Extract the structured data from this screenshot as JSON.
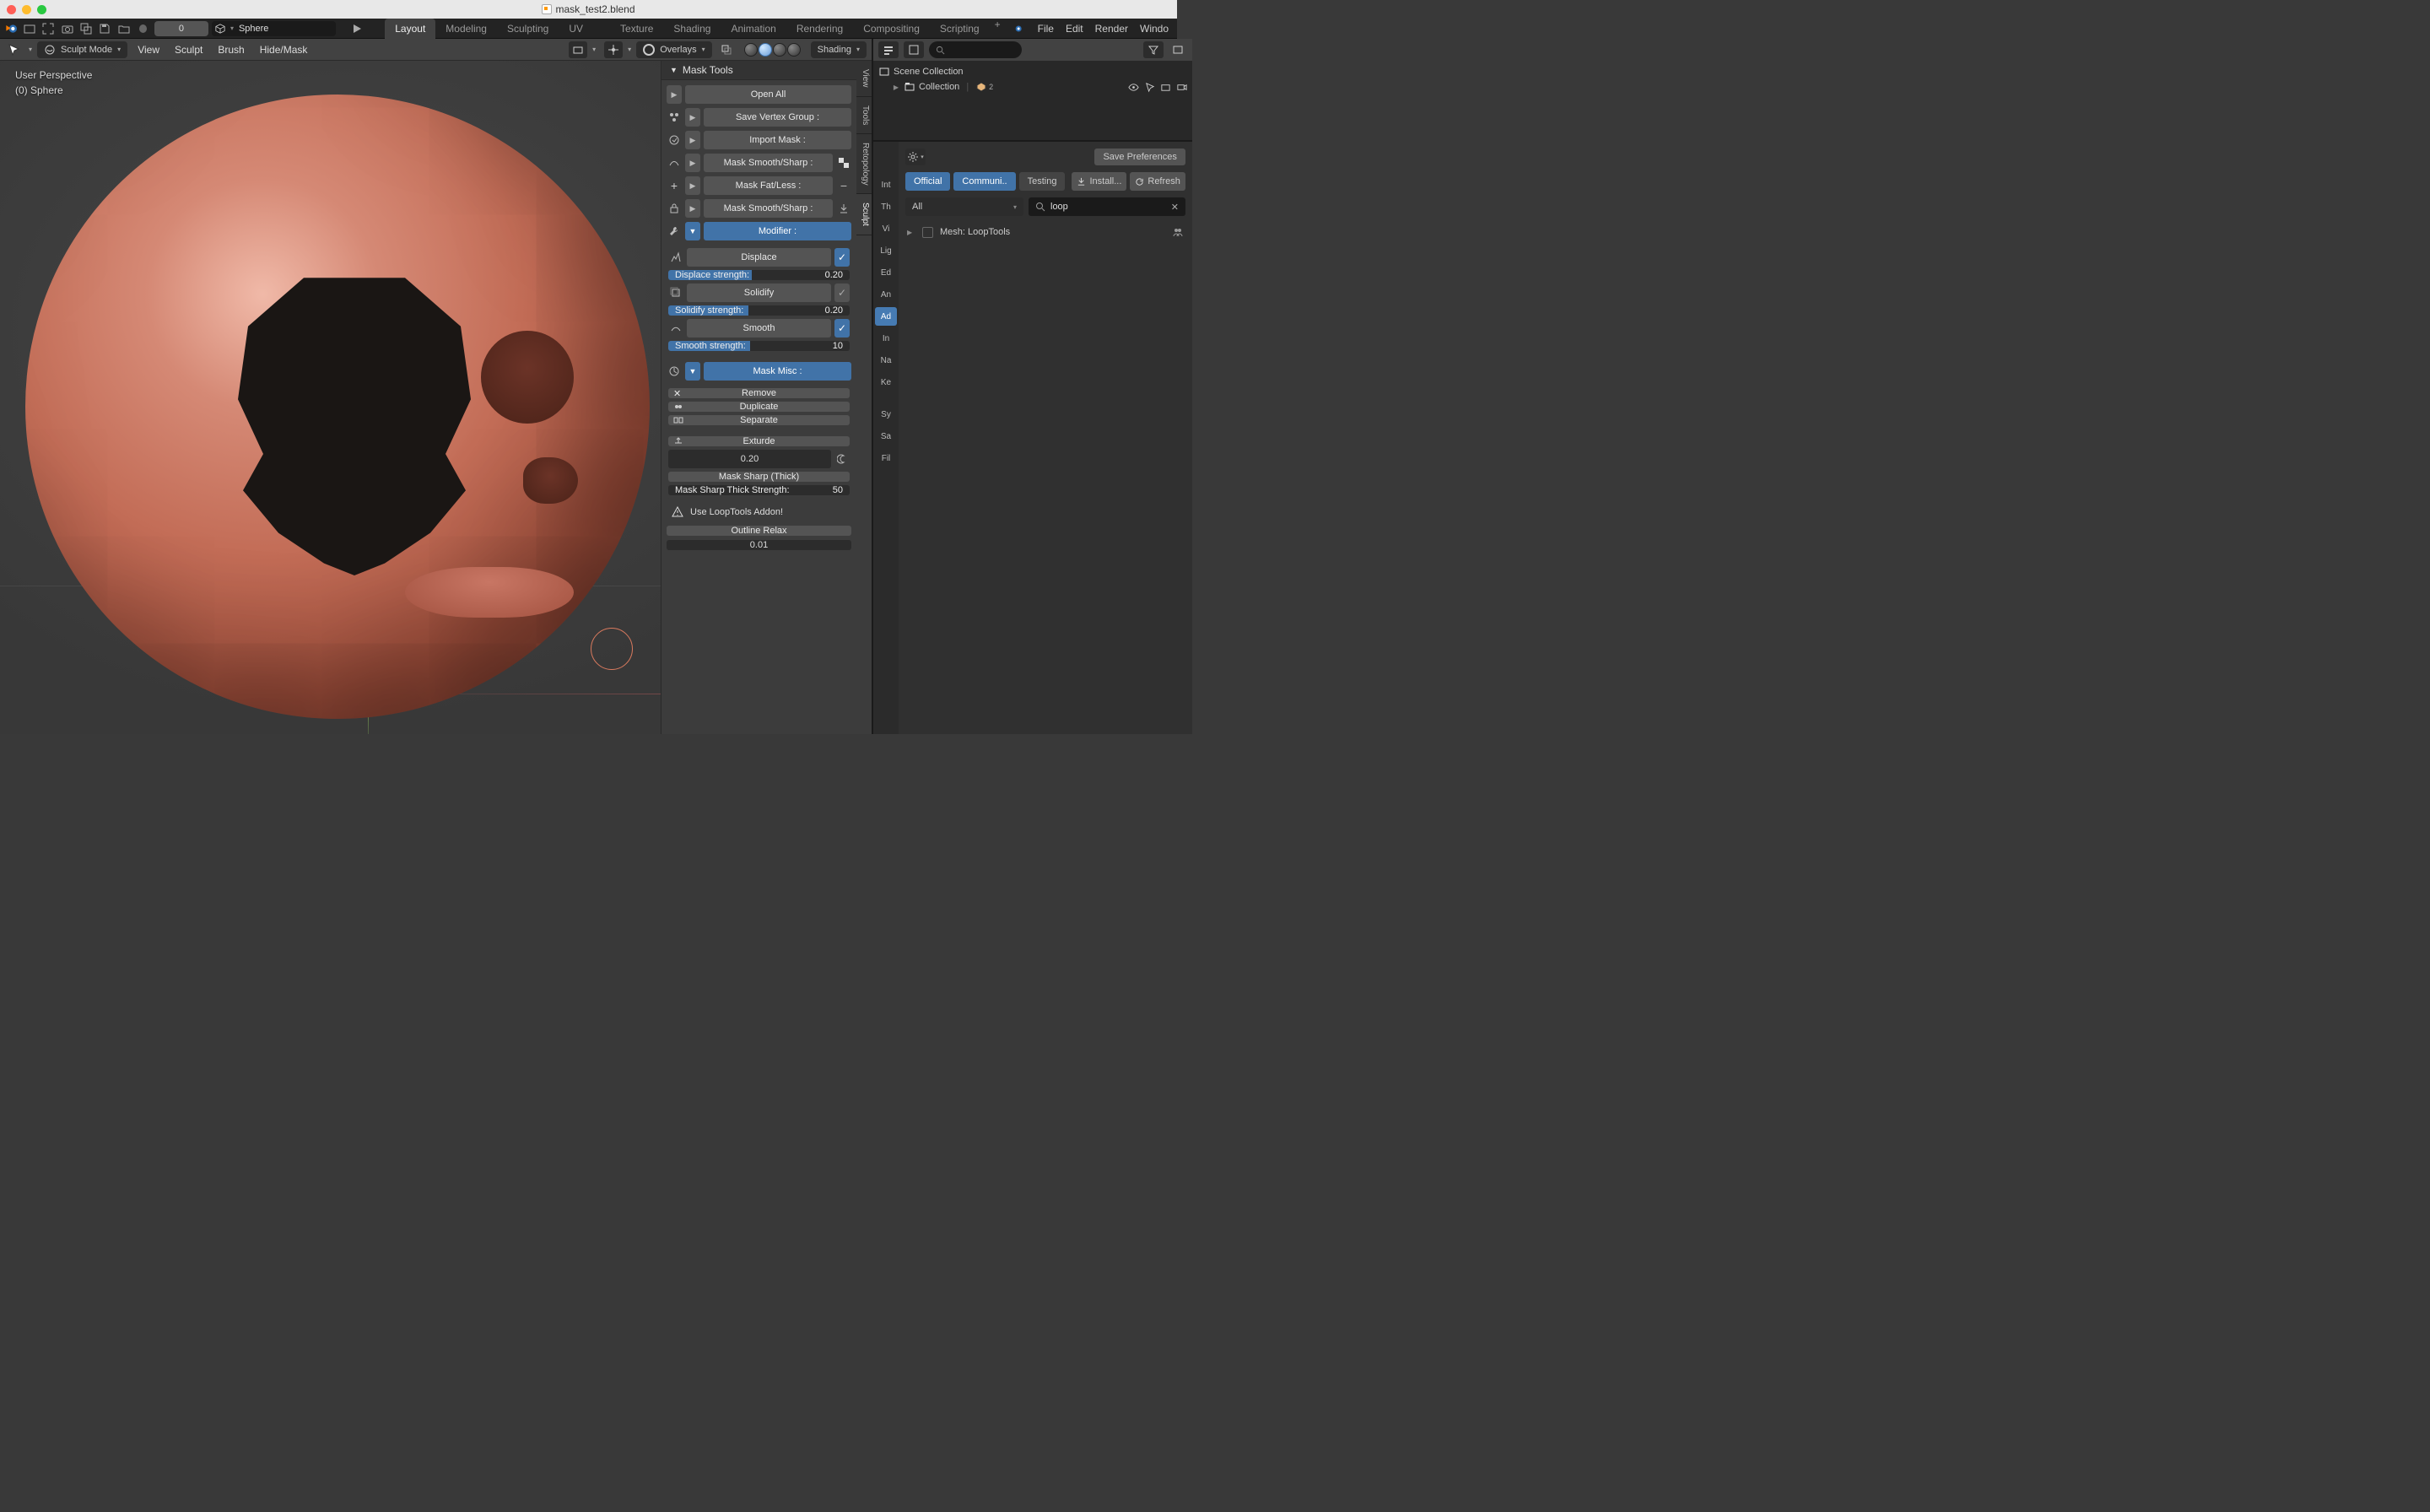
{
  "window": {
    "title": "mask_test2.blend"
  },
  "topbar": {
    "frame": "0",
    "object_name": "Sphere",
    "workspaces": [
      "Layout",
      "Modeling",
      "Sculpting",
      "UV Editing",
      "Texture Paint",
      "Shading",
      "Animation",
      "Rendering",
      "Compositing",
      "Scripting"
    ],
    "active_workspace": "Layout",
    "menus": [
      "File",
      "Edit",
      "Render",
      "Windo"
    ]
  },
  "viewport_header": {
    "mode": "Sculpt Mode",
    "menus": [
      "View",
      "Sculpt",
      "Brush",
      "Hide/Mask"
    ],
    "overlays_label": "Overlays",
    "shading_label": "Shading"
  },
  "viewport_info": {
    "line1": "User Perspective",
    "line2": "(0) Sphere"
  },
  "npanel": {
    "title": "Mask Tools",
    "open_all": "Open All",
    "save_vg": "Save Vertex Group :",
    "import_mask": "Import Mask :",
    "smooth_sharp1": "Mask Smooth/Sharp :",
    "fat_less": "Mask Fat/Less :",
    "smooth_sharp2": "Mask Smooth/Sharp :",
    "modifier_header": "Modifier :",
    "displace": "Displace",
    "displace_strength_label": "Displace strength:",
    "displace_strength_val": "0.20",
    "solidify": "Solidify",
    "solidify_strength_label": "Solidify strength:",
    "solidify_strength_val": "0.20",
    "smooth": "Smooth",
    "smooth_strength_label": "Smooth strength:",
    "smooth_strength_val": "10",
    "mask_misc_header": "Mask Misc :",
    "remove": "Remove",
    "duplicate": "Duplicate",
    "separate": "Separate",
    "exturde": "Exturde",
    "exturde_val": "0.20",
    "sharp_thick": "Mask Sharp (Thick)",
    "sharp_thick_strength_label": "Mask Sharp Thick Strength:",
    "sharp_thick_strength_val": "50",
    "looptools_warn": "Use LoopTools Addon!",
    "outline_relax": "Outline Relax",
    "outline_relax_val": "0.01",
    "vtabs": [
      "View",
      "Tools",
      "Retopology",
      "Sculpt"
    ]
  },
  "outliner": {
    "scene_collection": "Scene Collection",
    "collection": "Collection"
  },
  "props": {
    "save_prefs": "Save Preferences",
    "cats": {
      "official": "Official",
      "community": "Communi..",
      "testing": "Testing"
    },
    "install": "Install...",
    "refresh": "Refresh",
    "all_label": "All",
    "search_value": "loop",
    "addon_name": "Mesh: LoopTools",
    "tabs": [
      "Int",
      "Th",
      "Vi",
      "Lig",
      "Ed",
      "An",
      "Ad",
      "In",
      "Na",
      "Ke",
      "Sy",
      "Sa",
      "Fil"
    ],
    "active_tab": "Ad"
  }
}
